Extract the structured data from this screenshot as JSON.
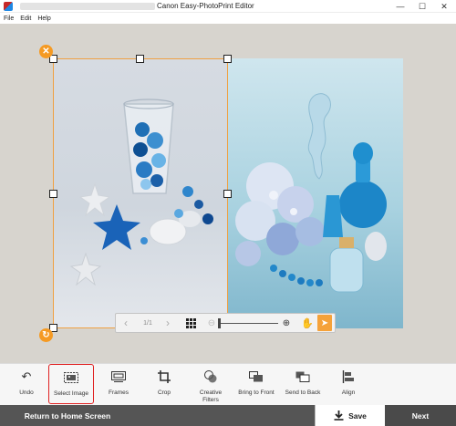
{
  "window": {
    "title": "Canon Easy-PhotoPrint Editor",
    "controls": {
      "minimize": "—",
      "maximize": "☐",
      "close": "✕"
    }
  },
  "menu": [
    "File",
    "Edit",
    "Help"
  ],
  "canvas": {
    "selection": {
      "delete_glyph": "✕",
      "rotate_glyph": "↻"
    }
  },
  "nav": {
    "prev": "‹",
    "page": "1/1",
    "next": "›",
    "zoom_out": "⊖",
    "zoom_in": "⊕",
    "hand": "✋",
    "pointer": "➤",
    "zoom_level": 0
  },
  "toolbar": {
    "items": [
      {
        "label": "Undo",
        "icon": "undo-icon",
        "glyph": "↶"
      },
      {
        "label": "Select Image",
        "icon": "select-image-icon",
        "glyph": "",
        "selected": true
      },
      {
        "label": "Frames",
        "icon": "frames-icon",
        "glyph": ""
      },
      {
        "label": "Crop",
        "icon": "crop-icon",
        "glyph": "⛶"
      },
      {
        "label": "Creative\nFilters",
        "icon": "creative-filters-icon",
        "glyph": ""
      },
      {
        "label": "Bring to Front",
        "icon": "bring-to-front-icon",
        "glyph": ""
      },
      {
        "label": "Send to Back",
        "icon": "send-to-back-icon",
        "glyph": ""
      },
      {
        "label": "Align",
        "icon": "align-icon",
        "glyph": ""
      }
    ]
  },
  "bottom": {
    "home": "Return to Home Screen",
    "save": "Save",
    "next": "Next"
  },
  "colors": {
    "accent": "#f59a23",
    "selected_outline": "#e02020",
    "bottom_bar": "#555555"
  }
}
